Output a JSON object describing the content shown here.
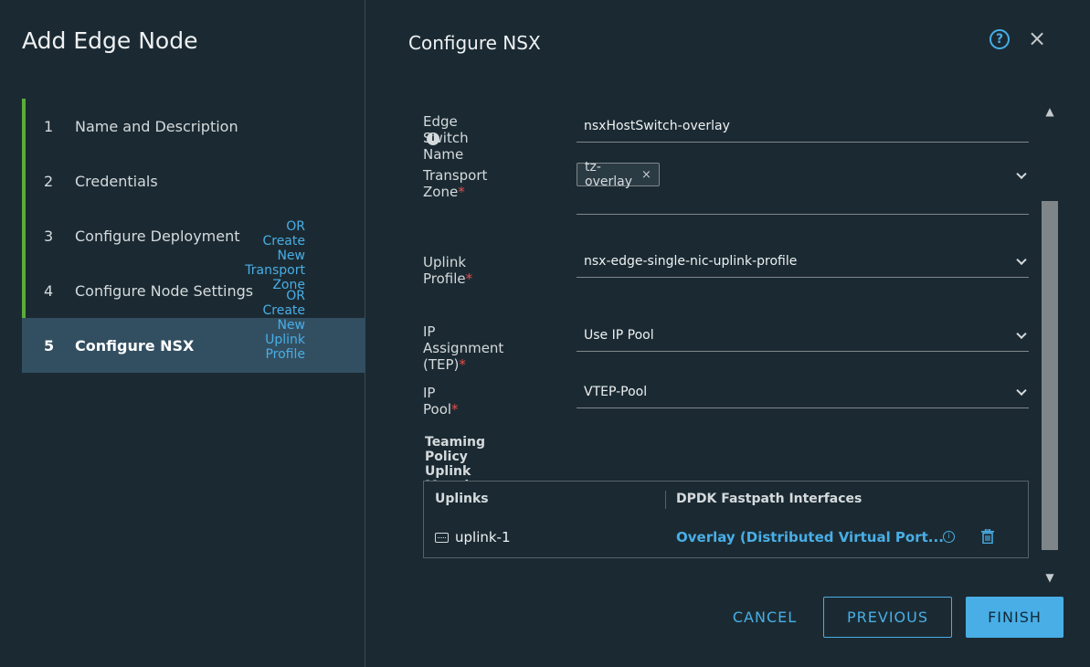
{
  "dialog": {
    "title": "Add Edge Node"
  },
  "steps": [
    {
      "num": "1",
      "label": "Name and Description"
    },
    {
      "num": "2",
      "label": "Credentials"
    },
    {
      "num": "3",
      "label": "Configure Deployment"
    },
    {
      "num": "4",
      "label": "Configure Node Settings"
    },
    {
      "num": "5",
      "label": "Configure NSX"
    }
  ],
  "panel": {
    "title": "Configure NSX"
  },
  "form": {
    "edge_switch_name": {
      "label": "Edge Switch Name",
      "value": "nsxHostSwitch-overlay"
    },
    "transport_zone": {
      "label": "Transport Zone",
      "tag": "tz-overlay",
      "tag_remove": "×",
      "create_link": "OR Create New Transport Zone"
    },
    "uplink_profile": {
      "label": "Uplink Profile",
      "value": "nsx-edge-single-nic-uplink-profile",
      "create_link": "OR Create New Uplink Profile"
    },
    "ip_assignment": {
      "label_line1": "IP Assignment",
      "label_line2": "(TEP)",
      "value": "Use IP Pool"
    },
    "ip_pool": {
      "label": "IP Pool",
      "value": "VTEP-Pool"
    },
    "required_marker": "*"
  },
  "teaming": {
    "title": "Teaming Policy Uplink Mapping",
    "columns": [
      "Uplinks",
      "DPDK Fastpath Interfaces"
    ],
    "rows": [
      {
        "uplink": "uplink-1",
        "interface": "Overlay (Distributed Virtual Port..."
      }
    ]
  },
  "buttons": {
    "cancel": "CANCEL",
    "previous": "PREVIOUS",
    "finish": "FINISH"
  },
  "icons": {
    "help": "?",
    "close": "×",
    "info": "i"
  },
  "colors": {
    "accent": "#49aee6",
    "step_done": "#5bad3a",
    "required": "#e74c4c",
    "active_step_bg": "#324f61"
  }
}
